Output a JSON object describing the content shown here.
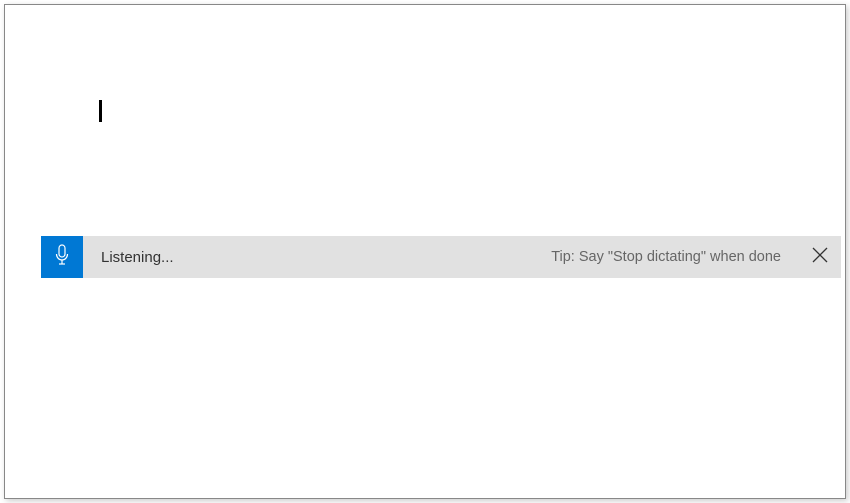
{
  "dictation": {
    "status_text": "Listening...",
    "tip_text": "Tip: Say \"Stop dictating\" when done",
    "mic_color": "#0078d4"
  },
  "document": {
    "content": ""
  }
}
